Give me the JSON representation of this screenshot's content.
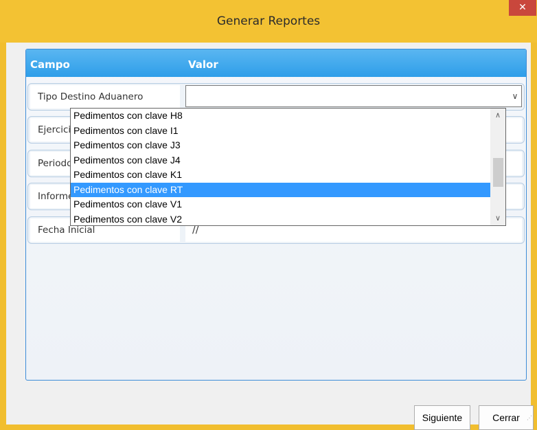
{
  "window": {
    "title": "Generar Reportes",
    "close_glyph": "✕"
  },
  "grid": {
    "col_campo": "Campo",
    "col_valor": "Valor",
    "rows": [
      {
        "label": "Tipo Destino Aduanero",
        "value": ""
      },
      {
        "label": "Ejercicio",
        "value": ""
      },
      {
        "label": "Periodo",
        "value": ""
      },
      {
        "label": "Informe",
        "value": ""
      },
      {
        "label": "Fecha Inicial",
        "value": "//"
      }
    ]
  },
  "dropdown": {
    "arrow_glyph": "∨",
    "items": [
      "Pedimentos con clave H8",
      "Pedimentos con clave I1",
      "Pedimentos con clave J3",
      "Pedimentos con clave J4",
      "Pedimentos con clave K1",
      "Pedimentos con clave RT",
      "Pedimentos con clave V1",
      "Pedimentos con clave V2"
    ],
    "selected_index": 5
  },
  "buttons": {
    "next": "Siguiente",
    "close": "Cerrar"
  },
  "icons": {
    "close": "close-icon",
    "combo": "chevron-down-icon",
    "scroll_up": "chevron-up-icon",
    "scroll_down": "chevron-down-icon",
    "grip": "resize-grip-icon"
  },
  "colors": {
    "titlebar": "#f3c233",
    "header": "#2e9ee9",
    "selection": "#3399ff",
    "close": "#c9473c"
  }
}
